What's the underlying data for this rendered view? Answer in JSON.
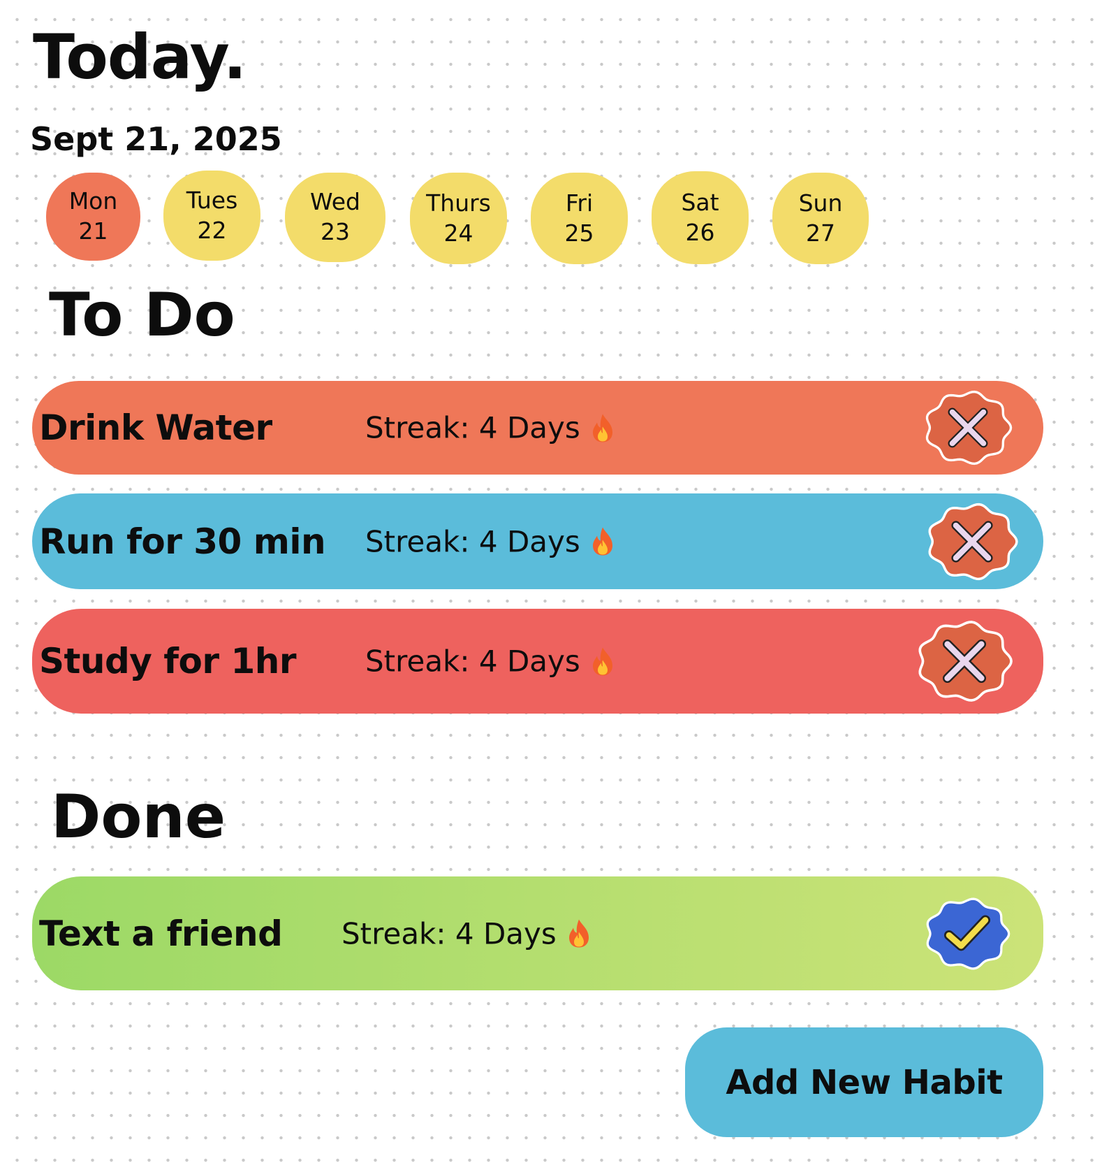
{
  "header": {
    "title": "Today.",
    "date": "Sept 21, 2025"
  },
  "week": {
    "selected_index": 0,
    "days": [
      {
        "name": "Mon",
        "num": "21",
        "color": "#ef7758"
      },
      {
        "name": "Tues",
        "num": "22",
        "color": "#f3dc6a"
      },
      {
        "name": "Wed",
        "num": "23",
        "color": "#f3dc6a"
      },
      {
        "name": "Thurs",
        "num": "24",
        "color": "#f3dc6a"
      },
      {
        "name": "Fri",
        "num": "25",
        "color": "#f3dc6a"
      },
      {
        "name": "Sat",
        "num": "26",
        "color": "#f3dc6a"
      },
      {
        "name": "Sun",
        "num": "27",
        "color": "#f3dc6a"
      }
    ]
  },
  "todo": {
    "heading": "To Do",
    "habits": [
      {
        "name": "Drink Water",
        "streak": "Streak: 4 Days",
        "color": "#ef7758",
        "status_icon": "x-badge-icon"
      },
      {
        "name": "Run for 30 min",
        "streak": "Streak: 4 Days",
        "color": "#5bbcda",
        "status_icon": "x-badge-icon"
      },
      {
        "name": "Study for 1hr",
        "streak": "Streak: 4 Days",
        "color": "#ee625e",
        "status_icon": "x-badge-icon"
      }
    ]
  },
  "done": {
    "heading": "Done",
    "habits": [
      {
        "name": "Text a friend",
        "streak": "Streak: 4 Days",
        "color_start": "#9cd966",
        "color_end": "#cce378",
        "status_icon": "check-badge-icon"
      }
    ]
  },
  "actions": {
    "add_label": "Add New Habit"
  },
  "colors": {
    "x_badge_fill": "#dc6444",
    "x_mark": "#ead7ee",
    "check_badge_fill": "#3b66d4",
    "check_mark": "#f3dc4a",
    "add_button": "#5bbcda"
  }
}
